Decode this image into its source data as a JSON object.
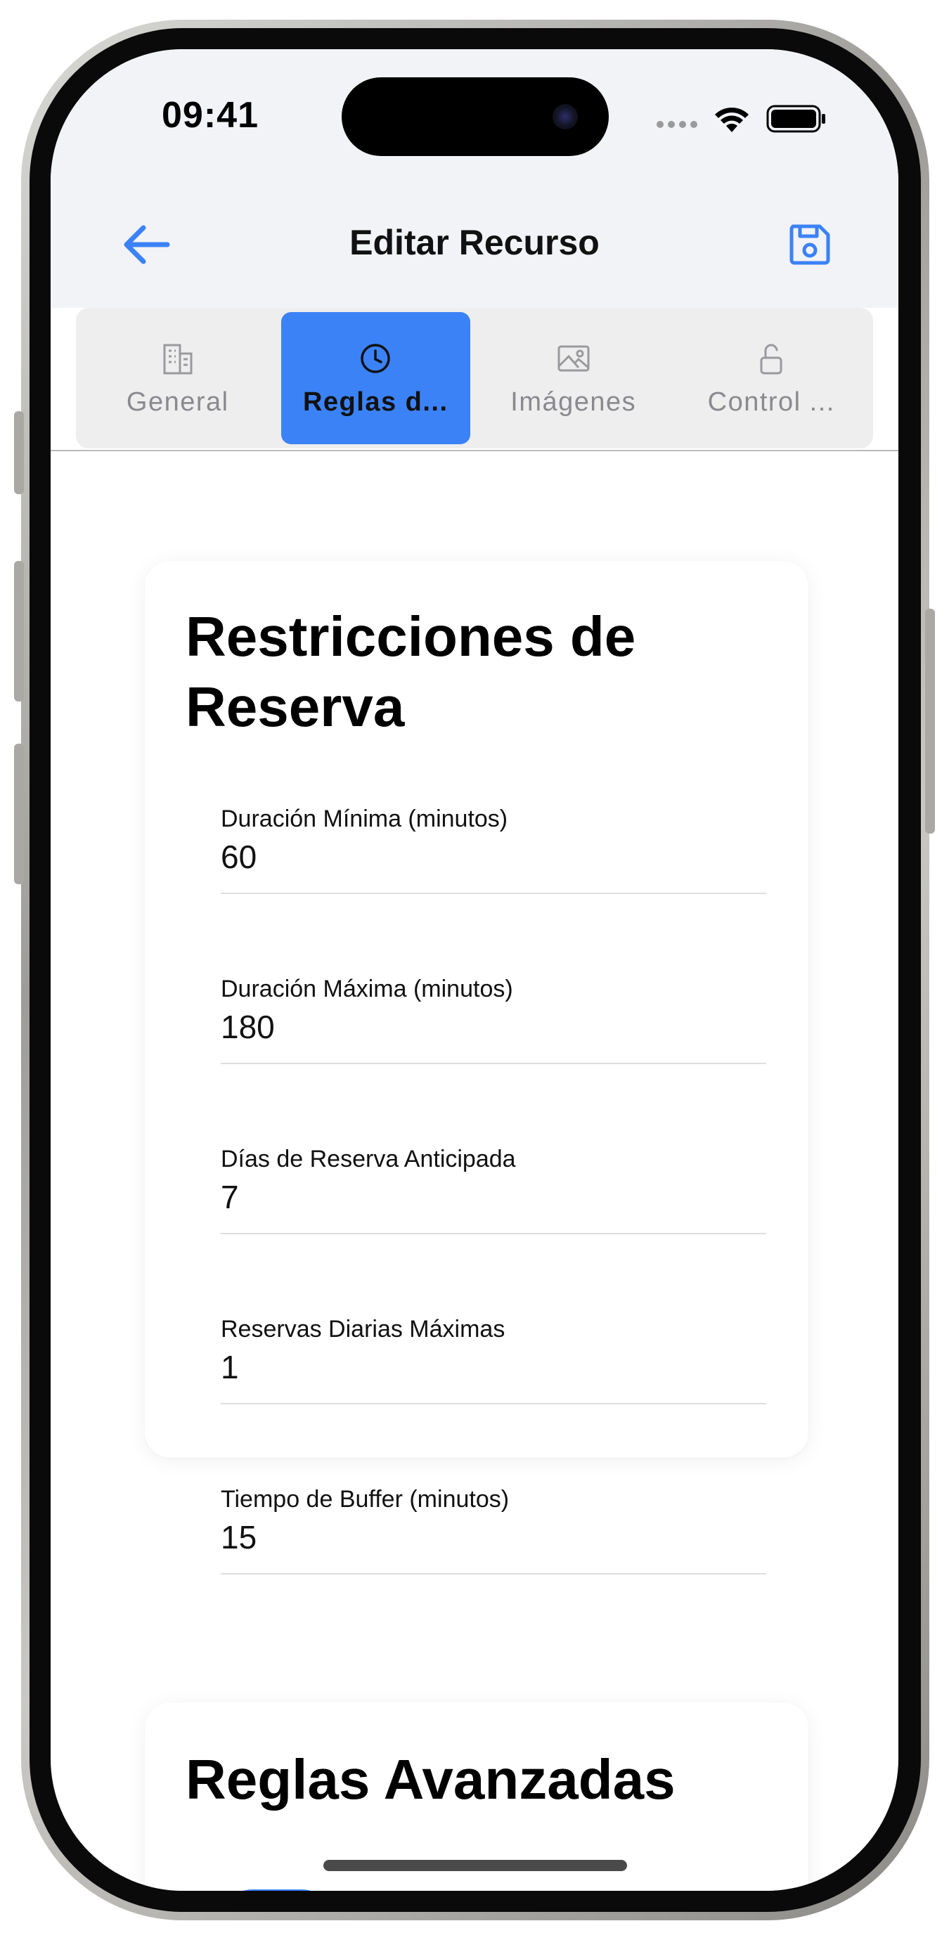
{
  "status_bar": {
    "time": "09:41"
  },
  "header": {
    "title": "Editar Recurso"
  },
  "tabs": [
    {
      "label": "General",
      "icon": "building-icon",
      "active": false
    },
    {
      "label": "Reglas d...",
      "icon": "clock-icon",
      "active": true
    },
    {
      "label": "Imágenes",
      "icon": "image-icon",
      "active": false
    },
    {
      "label": "Control ...",
      "icon": "unlock-icon",
      "active": false
    }
  ],
  "restrictions": {
    "title": "Restricciones de Reserva",
    "fields": [
      {
        "label": "Duración Mínima (minutos)",
        "value": "60"
      },
      {
        "label": "Duración Máxima (minutos)",
        "value": "180"
      },
      {
        "label": "Días de Reserva Anticipada",
        "value": "7"
      },
      {
        "label": "Reservas Diarias Máximas",
        "value": "1"
      },
      {
        "label": "Tiempo de Buffer (minutos)",
        "value": "15"
      }
    ]
  },
  "advanced": {
    "title": "Reglas Avanzadas",
    "toggle_on": true
  },
  "colors": {
    "accent": "#3b82f6",
    "header_bg": "#f2f3f7"
  }
}
